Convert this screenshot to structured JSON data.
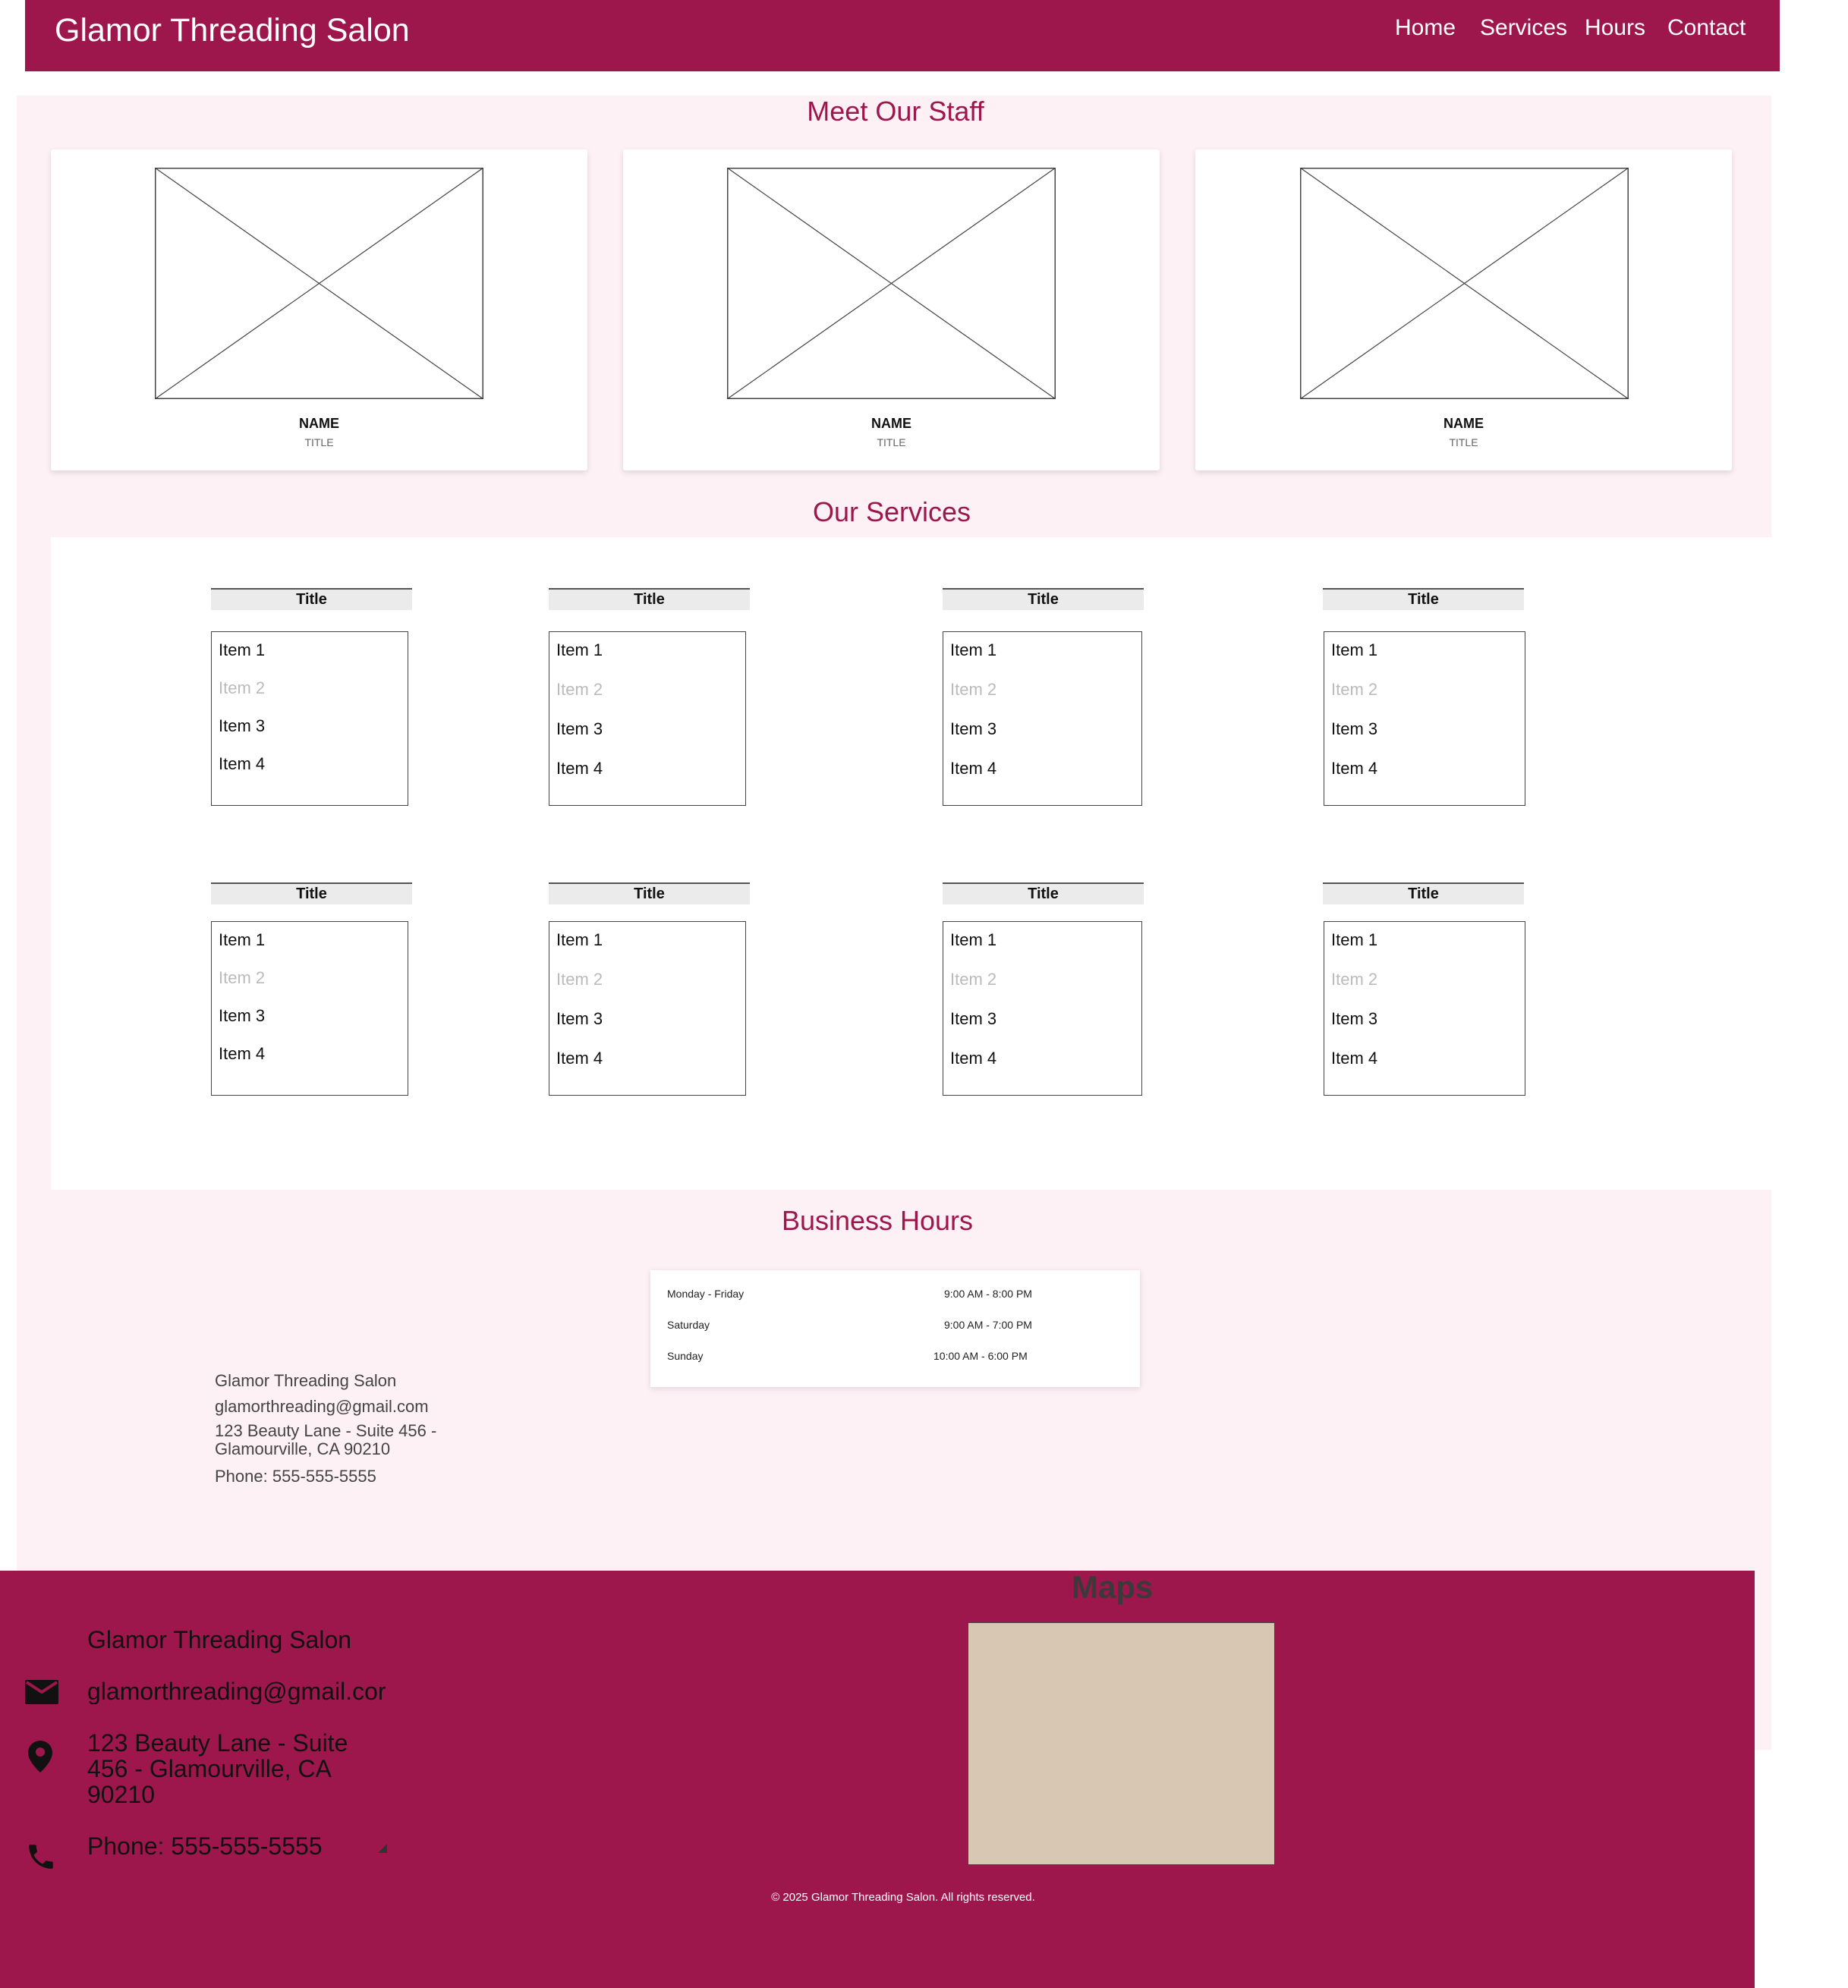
{
  "header": {
    "title": "Glamor Threading Salon",
    "nav": [
      "Home",
      "Services",
      "Hours",
      "Contact"
    ]
  },
  "staff": {
    "heading": "Meet Our Staff",
    "members": [
      {
        "name": "NAME",
        "title": "TITLE"
      },
      {
        "name": "NAME",
        "title": "TITLE"
      },
      {
        "name": "NAME",
        "title": "TITLE"
      }
    ]
  },
  "services": {
    "heading": "Our Services",
    "cards": [
      {
        "title": "Title",
        "items": [
          "Item 1",
          "Item 2",
          "Item 3",
          "Item 4"
        ]
      },
      {
        "title": "Title",
        "items": [
          "Item 1",
          "Item 2",
          "Item 3",
          "Item 4"
        ]
      },
      {
        "title": "Title",
        "items": [
          "Item 1",
          "Item 2",
          "Item 3",
          "Item 4"
        ]
      },
      {
        "title": "Title",
        "items": [
          "Item 1",
          "Item 2",
          "Item 3",
          "Item 4"
        ]
      },
      {
        "title": "Title",
        "items": [
          "Item 1",
          "Item 2",
          "Item 3",
          "Item 4"
        ]
      },
      {
        "title": "Title",
        "items": [
          "Item 1",
          "Item 2",
          "Item 3",
          "Item 4"
        ]
      },
      {
        "title": "Title",
        "items": [
          "Item 1",
          "Item 2",
          "Item 3",
          "Item 4"
        ]
      },
      {
        "title": "Title",
        "items": [
          "Item 1",
          "Item 2",
          "Item 3",
          "Item 4"
        ]
      }
    ]
  },
  "hours": {
    "heading": "Business Hours",
    "rows": [
      {
        "day": "Monday - Friday",
        "time": "9:00 AM - 8:00 PM"
      },
      {
        "day": "Saturday",
        "time": "9:00 AM - 7:00 PM"
      },
      {
        "day": "Sunday",
        "time": "10:00 AM - 6:00 PM"
      }
    ]
  },
  "contact": {
    "name": "Glamor Threading Salon",
    "email": "glamorthreading@gmail.com",
    "address_line1": "123 Beauty Lane - Suite 456 -",
    "address_line2": "Glamourville, CA 90210",
    "phone": "Phone: 555-555-5555"
  },
  "footer": {
    "name": "Glamor Threading Salon",
    "email": "glamorthreading@gmail.cor",
    "address_line1": "123 Beauty Lane - Suite",
    "address_line2": "456 - Glamourville, CA",
    "address_line3": "90210",
    "phone": "Phone: 555-555-5555",
    "maps_heading": "Maps",
    "copyright": "© 2025 Glamor Threading Salon. All rights reserved.",
    "icons": [
      "mail-icon",
      "location-pin-icon",
      "phone-icon"
    ]
  },
  "colors": {
    "brand": "#9e174c",
    "pink_background": "#fdf1f6",
    "map_placeholder": "#d8c8b3"
  }
}
